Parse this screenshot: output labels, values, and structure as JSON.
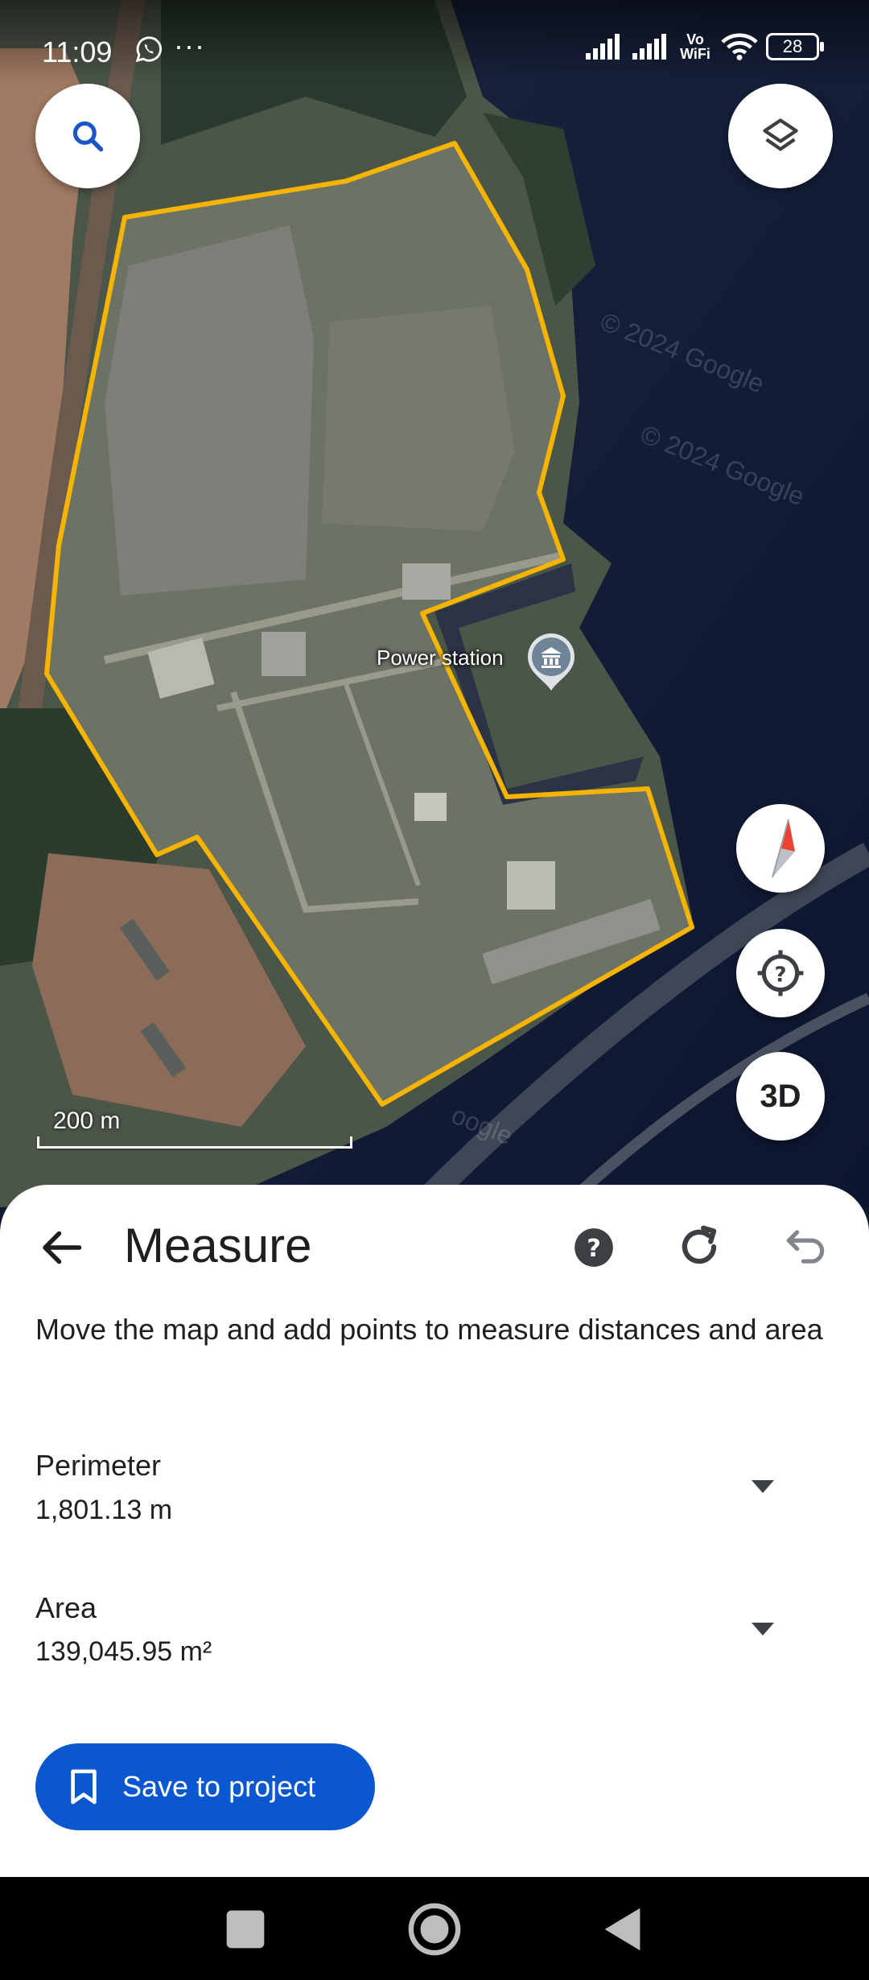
{
  "status_bar": {
    "time": "11:09",
    "dots": "···",
    "vowifi": "Vo\nWiFi",
    "battery": "28"
  },
  "map": {
    "poi_label": "Power station",
    "scale_label": "200 m",
    "btn_3d": "3D",
    "watermarks": [
      "© 2024 Google",
      "© 2024 Google",
      "oogle"
    ],
    "polygon_color": "#f4b400"
  },
  "measure": {
    "title": "Measure",
    "description": "Move the map and add points to measure distances and area",
    "perimeter": {
      "label": "Perimeter",
      "value": "1,801.13 m"
    },
    "area": {
      "label": "Area",
      "value": "139,045.95 m²"
    },
    "save_label": "Save to project",
    "accent": "#0b57d0"
  }
}
